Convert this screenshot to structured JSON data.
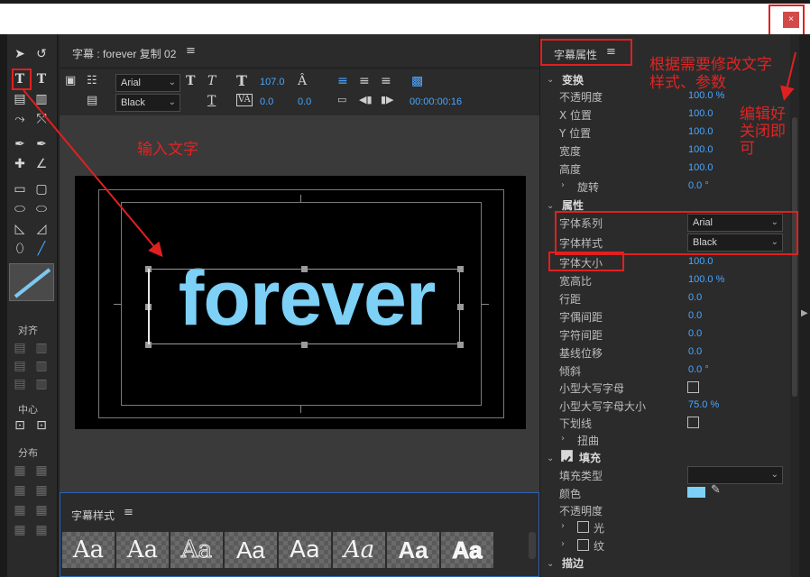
{
  "window": {
    "close_label": "×"
  },
  "toolpanel": {
    "align_label": "对齐",
    "center_label": "中心",
    "distribute_label": "分布"
  },
  "titler": {
    "title": "字幕 : forever 复制 02",
    "font_family": "Arial",
    "font_style": "Black",
    "font_size": "107.0",
    "kerning": "0.0",
    "leading": "0.0",
    "timecode": "00:00:00:16",
    "canvas_text": "forever"
  },
  "styles": {
    "title": "字幕样式",
    "swatch_label": "Aa"
  },
  "props": {
    "title": "字幕属性",
    "transform_section": "变换",
    "opacity_label": "不透明度",
    "opacity_value": "100.0 %",
    "x_label": "X 位置",
    "x_value": "100.0",
    "y_label": "Y 位置",
    "y_value": "100.0",
    "width_label": "宽度",
    "width_value": "100.0",
    "height_label": "高度",
    "height_value": "100.0",
    "rotation_label": "旋转",
    "rotation_value": "0.0 °",
    "properties_section": "属性",
    "font_family_label": "字体系列",
    "font_family_value": "Arial",
    "font_style_label": "字体样式",
    "font_style_value": "Black",
    "font_size_label": "字体大小",
    "font_size_value": "100.0",
    "aspect_label": "宽高比",
    "aspect_value": "100.0 %",
    "leading_label": "行距",
    "leading_value": "0.0",
    "kerning_label": "字偶间距",
    "kerning_value": "0.0",
    "tracking_label": "字符间距",
    "tracking_value": "0.0",
    "baseline_label": "基线位移",
    "baseline_value": "0.0",
    "slant_label": "倾斜",
    "slant_value": "0.0 °",
    "small_caps_label": "小型大写字母",
    "small_caps_size_label": "小型大写字母大小",
    "small_caps_size_value": "75.0 %",
    "underline_label": "下划线",
    "distort_label": "扭曲",
    "fill_section": "填充",
    "fill_type_label": "填充类型",
    "color_label": "颜色",
    "fill_opacity_label": "不透明度",
    "sheen_label": "光",
    "texture_label": "纹",
    "stroke_section": "描边"
  },
  "annotations": {
    "input_text": "输入文字",
    "modify_text": "根据需要修改文字\n样式、参数",
    "close_text": "编辑好\n关闭即\n可"
  },
  "colors": {
    "accent": "#4aa6ff",
    "annotation": "#e02020",
    "text_fill": "#7dd0f6"
  }
}
